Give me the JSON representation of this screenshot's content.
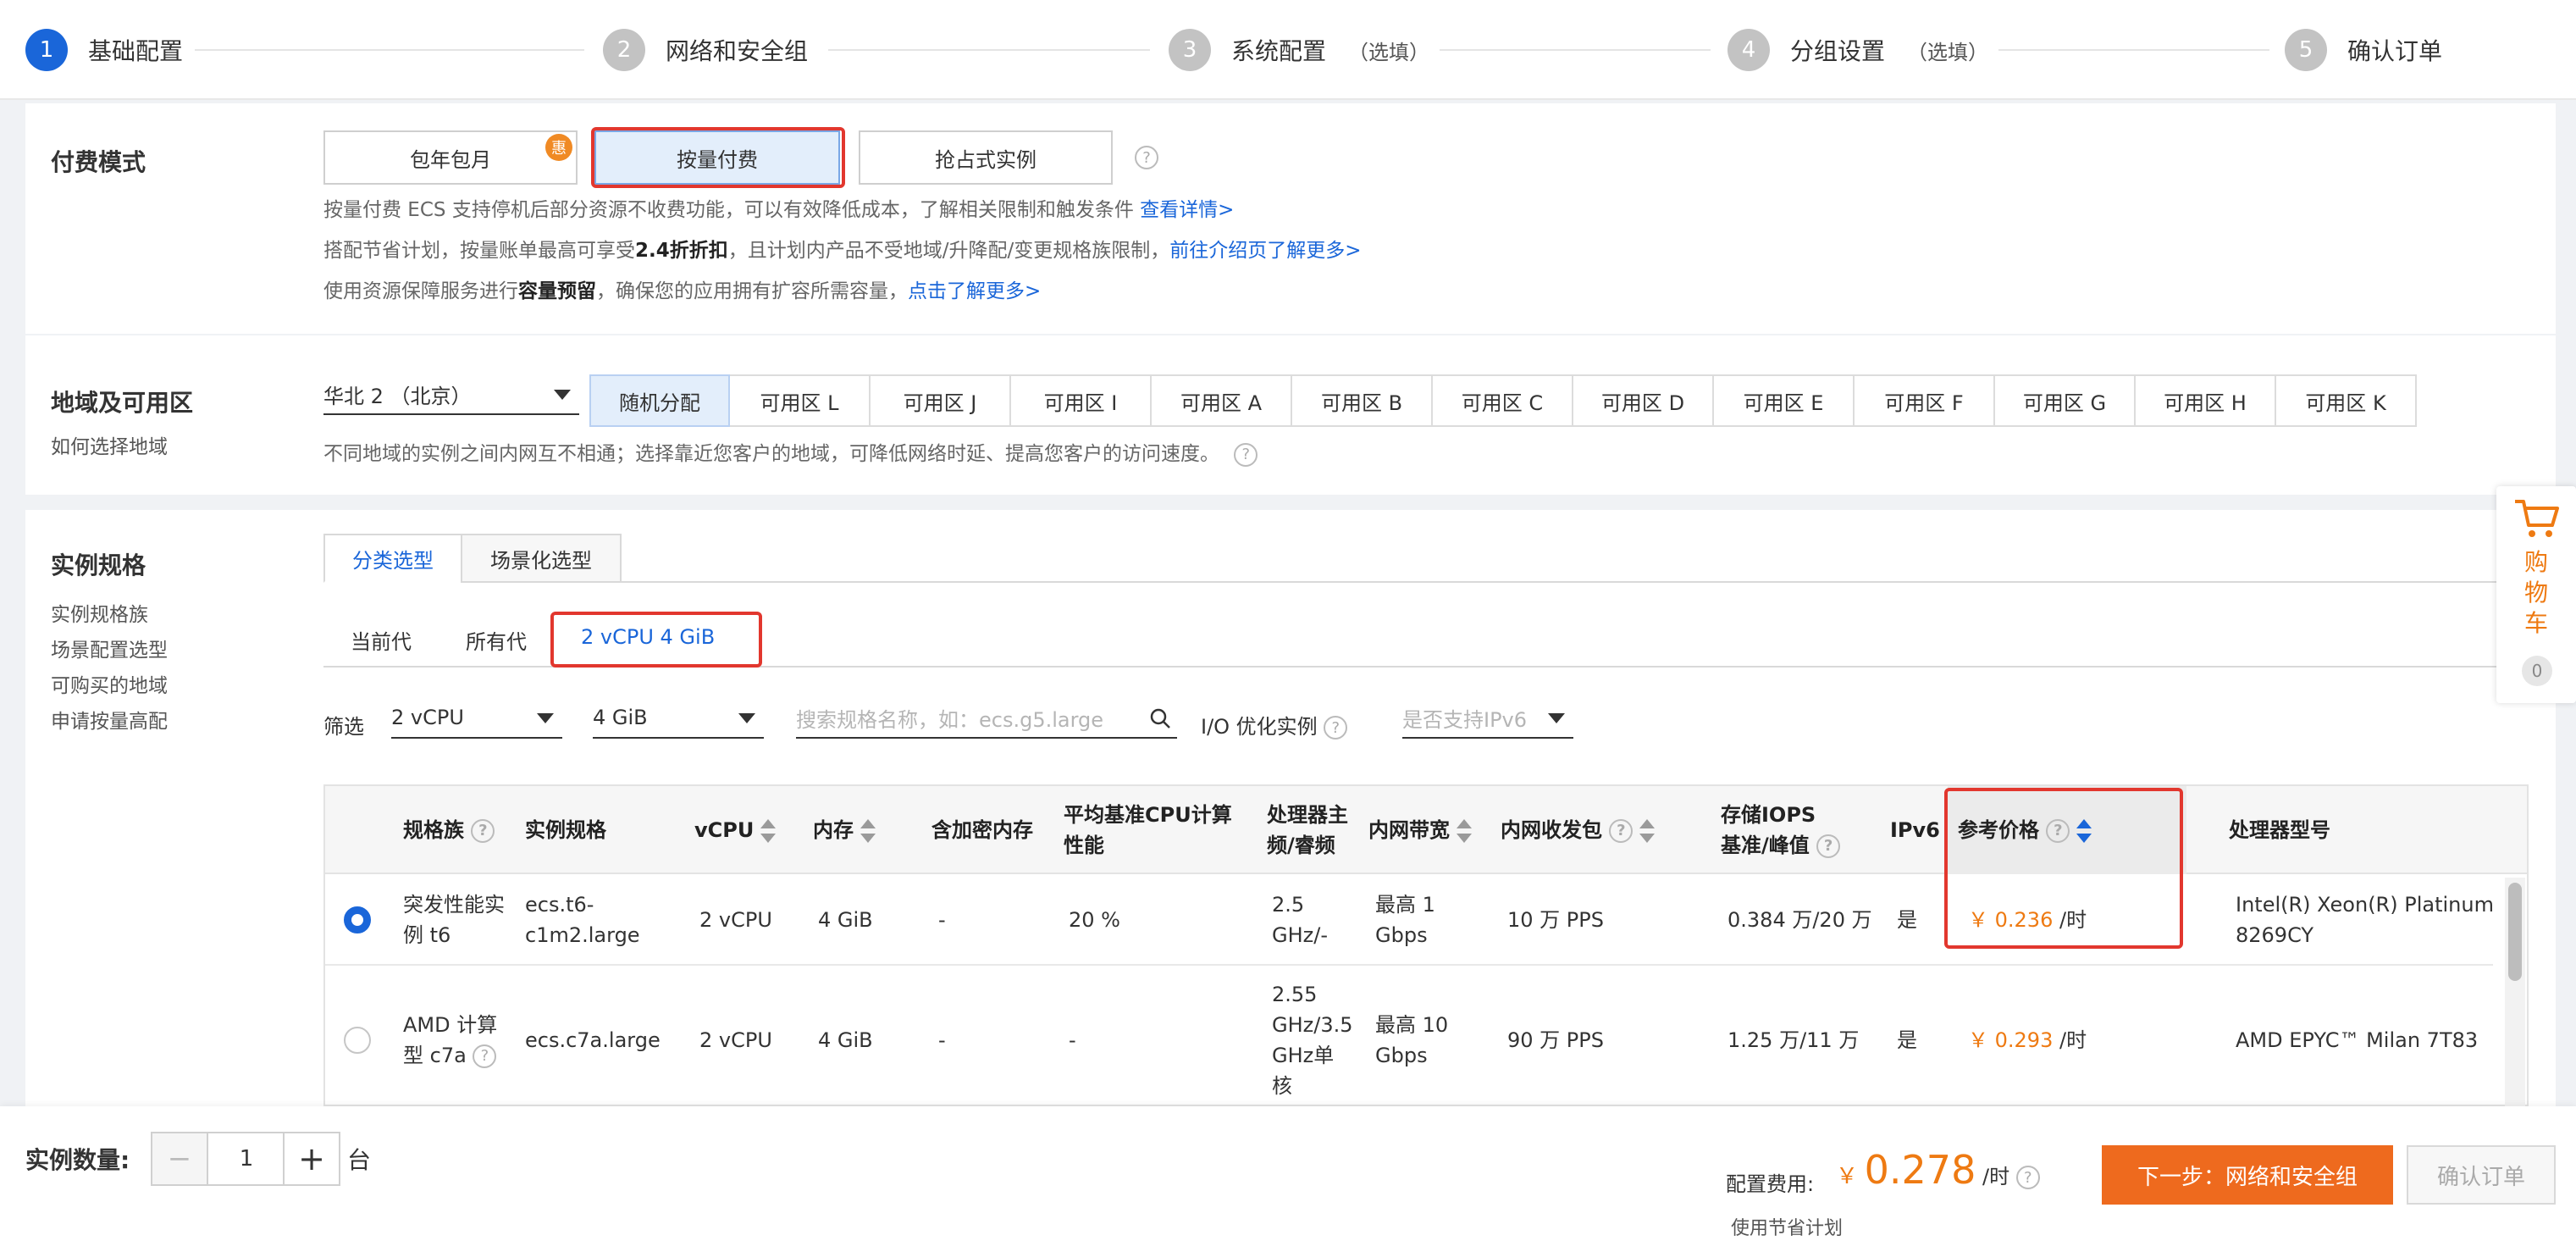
{
  "steps": [
    {
      "num": "1",
      "name": "基础配置",
      "opt": ""
    },
    {
      "num": "2",
      "name": "网络和安全组",
      "opt": ""
    },
    {
      "num": "3",
      "name": "系统配置",
      "opt": "（选填）"
    },
    {
      "num": "4",
      "name": "分组设置",
      "opt": "（选填）"
    },
    {
      "num": "5",
      "name": "确认订单",
      "opt": ""
    }
  ],
  "billing": {
    "title": "付费模式",
    "options": [
      "包年包月",
      "按量付费",
      "抢占式实例"
    ],
    "badge": "惠",
    "note1": "按量付费 ECS 支持停机后部分资源不收费功能，可以有效降低成本，了解相关限制和触发条件",
    "note1_link": "查看详情>",
    "note2_a": "搭配节省计划，按量账单最高可享受",
    "note2_b": "2.4折折扣",
    "note2_c": "，且计划内产品不受地域/升降配/变更规格族限制，",
    "note2_link": "前往介绍页了解更多>",
    "note3_a": "使用资源保障服务进行",
    "note3_b": "容量预留",
    "note3_c": "，确保您的应用拥有扩容所需容量，",
    "note3_link": "点击了解更多>"
  },
  "region": {
    "title": "地域及可用区",
    "help_link": "如何选择地域",
    "selected": "华北 2 （北京）",
    "zones": [
      "随机分配",
      "可用区 L",
      "可用区 J",
      "可用区 I",
      "可用区 A",
      "可用区 B",
      "可用区 C",
      "可用区 D",
      "可用区 E",
      "可用区 F",
      "可用区 G",
      "可用区 H",
      "可用区 K"
    ],
    "note": "不同地域的实例之间内网互不相通；选择靠近您客户的地域，可降低网络时延、提高您客户的访问速度。"
  },
  "spec": {
    "title": "实例规格",
    "side_links": [
      "实例规格族",
      "场景配置选型",
      "可购买的地域",
      "申请按量高配"
    ],
    "tabs": [
      "分类选型",
      "场景化选型"
    ],
    "sub_tabs": [
      "当前代",
      "所有代",
      "2 vCPU 4 GiB"
    ],
    "filter_label": "筛选",
    "vcpu_value": "2 vCPU",
    "mem_value": "4 GiB",
    "search_placeholder": "搜索规格名称，如：ecs.g5.large",
    "io_label": "I/O 优化实例",
    "ipv6_placeholder": "是否支持IPv6",
    "headers": {
      "family": "规格族",
      "spec": "实例规格",
      "vcpu": "vCPU",
      "mem": "内存",
      "enc": "含加密内存",
      "cpu1": "平均基准CPU计算",
      "cpu2": "性能",
      "freq1": "处理器主",
      "freq2": "频/睿频",
      "bw": "内网带宽",
      "pps": "内网收发包",
      "iops1": "存储IOPS",
      "iops2": "基准/峰值",
      "ipv6": "IPv6",
      "price": "参考价格",
      "model": "处理器型号"
    },
    "rows": [
      {
        "family1": "突发性能实",
        "family2": "例 t6",
        "spec1": "ecs.t6-",
        "spec2": "c1m2.large",
        "vcpu": "2 vCPU",
        "mem": "4 GiB",
        "enc": "-",
        "cpu": "20 %",
        "freq1": "2.5",
        "freq2": "GHz/-",
        "bw1": "最高 1",
        "bw2": "Gbps",
        "pps": "10 万 PPS",
        "iops": "0.384 万/20 万",
        "ipv6": "是",
        "price": "￥ 0.236",
        "unit": "/时",
        "model1": "Intel(R) Xeon(R) Platinum",
        "model2": "8269CY"
      },
      {
        "family1": "AMD 计算",
        "family2": "型 c7a",
        "spec1": "ecs.c7a.large",
        "vcpu": "2 vCPU",
        "mem": "4 GiB",
        "enc": "-",
        "cpu": "-",
        "freq1": "2.55",
        "freq2": "GHz/3.5",
        "freq3": "GHz单",
        "freq4": "核",
        "bw1": "最高 10",
        "bw2": "Gbps",
        "pps": "90 万 PPS",
        "iops": "1.25 万/11 万",
        "ipv6": "是",
        "price": "￥ 0.293",
        "unit": "/时",
        "model1": "AMD EPYC™ Milan 7T83"
      }
    ]
  },
  "cart": {
    "label": "购物车",
    "count": "0"
  },
  "bottom": {
    "qty_label": "实例数量:",
    "qty_value": "1",
    "qty_unit": "台",
    "fee_label": "配置费用:",
    "fee_currency": "￥",
    "fee_value": "0.278",
    "fee_unit": "/时",
    "next_button": "下一步：网络和安全组",
    "confirm_button": "确认订单",
    "saving_label": "使用节省计划"
  },
  "colors": {
    "accent": "#1a66d9",
    "price": "#ee7a12",
    "highlight": "#e2372e"
  }
}
